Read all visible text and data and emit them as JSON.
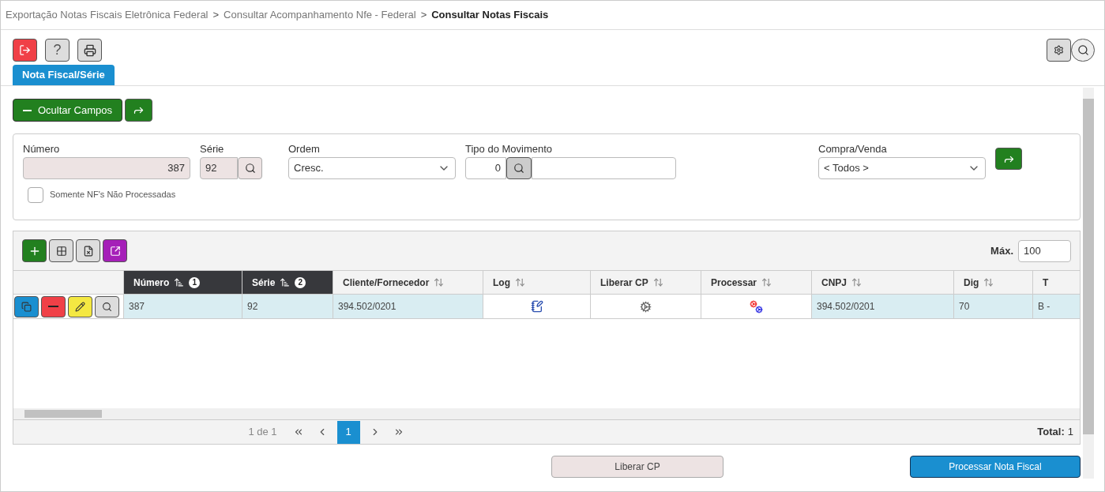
{
  "breadcrumb": [
    {
      "label": "Exportação Notas Fiscais Eletrônica Federal",
      "current": false
    },
    {
      "label": "Consultar Acompanhamento Nfe - Federal",
      "current": false
    },
    {
      "label": "Consultar Notas Fiscais",
      "current": true
    }
  ],
  "breadcrumb_separator": ">",
  "help_button": "?",
  "tabs": [
    {
      "label": "Nota Fiscal/Série",
      "selected": true
    }
  ],
  "hide_fields_button": "Ocultar Campos",
  "filters": {
    "numero": {
      "label": "Número",
      "value": "387"
    },
    "serie": {
      "label": "Série",
      "value": "92"
    },
    "ordem": {
      "label": "Ordem",
      "value": "Cresc."
    },
    "tipo_movimento": {
      "label": "Tipo do Movimento",
      "value": "0"
    },
    "compra_venda": {
      "label": "Compra/Venda",
      "value": "< Todos >"
    }
  },
  "only_unprocessed": {
    "label": "Somente NF's Não Processadas",
    "checked": false
  },
  "grid": {
    "max_label": "Máx.",
    "max_value": "100",
    "columns": [
      {
        "label": "Número",
        "sorted": true,
        "order": "1"
      },
      {
        "label": "Série",
        "sorted": true,
        "order": "2"
      },
      {
        "label": "Cliente/Fornecedor",
        "sorted": false
      },
      {
        "label": "Log",
        "sorted": false
      },
      {
        "label": "Liberar CP",
        "sorted": false
      },
      {
        "label": "Processar",
        "sorted": false
      },
      {
        "label": "CNPJ",
        "sorted": false
      },
      {
        "label": "Dig",
        "sorted": false
      },
      {
        "label": "T",
        "sorted": false
      }
    ],
    "rows": [
      {
        "selected": true,
        "cells": [
          {
            "kind": "text",
            "text": "387"
          },
          {
            "kind": "text",
            "text": "92"
          },
          {
            "kind": "text",
            "text": "394.502/0201"
          },
          {
            "kind": "notebook"
          },
          {
            "kind": "gears"
          },
          {
            "kind": "colorgears"
          },
          {
            "kind": "text",
            "text": "394.502/0201"
          },
          {
            "kind": "text",
            "text": "70"
          },
          {
            "kind": "text",
            "text": "B -"
          }
        ]
      }
    ]
  },
  "pagination": {
    "summary": "1 de 1",
    "pages": [
      {
        "label": "1",
        "selected": true
      }
    ],
    "total_label": "Total:",
    "total_value": "1"
  },
  "footer_buttons": [
    {
      "label": "Liberar CP",
      "kind": "secondary"
    },
    {
      "label": "Processar Nota Fiscal",
      "kind": "primary"
    }
  ]
}
